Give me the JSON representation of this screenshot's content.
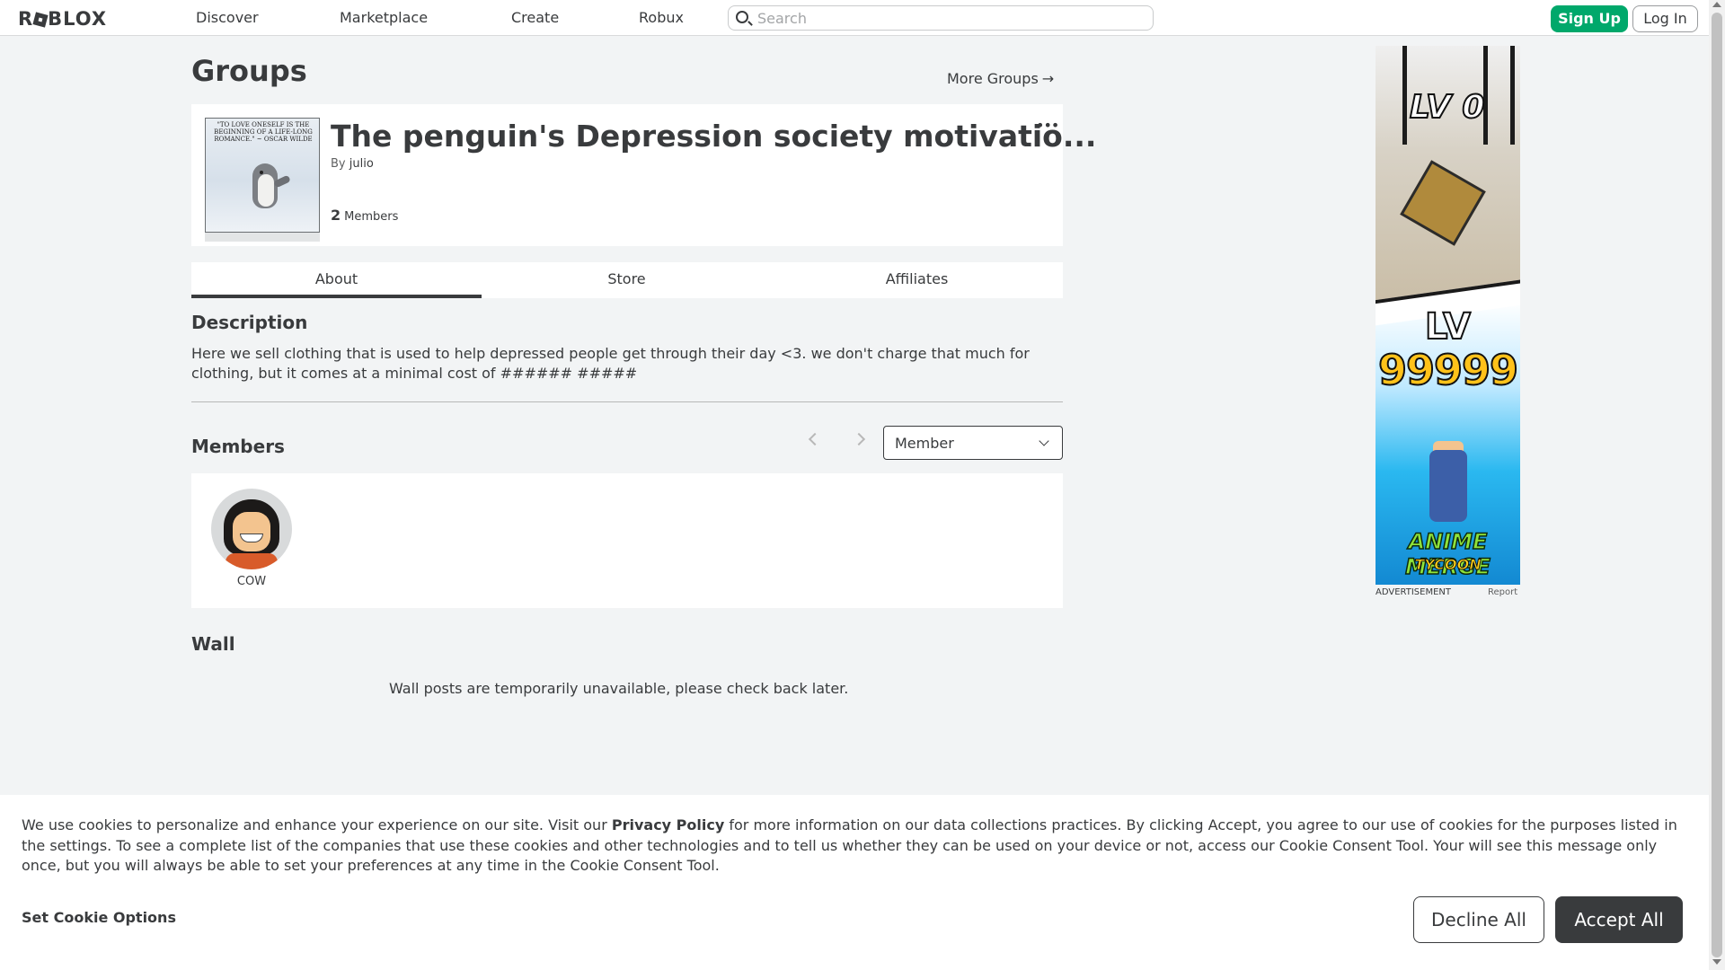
{
  "nav": {
    "logo": "ROBLOX",
    "links": [
      "Discover",
      "Marketplace",
      "Create",
      "Robux"
    ],
    "search_placeholder": "Search",
    "signup": "Sign Up",
    "login": "Log In"
  },
  "page": {
    "title": "Groups",
    "more_groups": "More Groups",
    "more_groups_arrow": "→"
  },
  "group": {
    "name": "The penguin's Depression society motivatio...",
    "by_label": "By",
    "owner": "julio",
    "member_count": "2",
    "members_label": "Members",
    "more_dots": "•••",
    "thumb_quote": "\"TO LOVE ONESELF IS THE BEGINNING OF A LIFE-LONG ROMANCE.\" ~ OSCAR WILDE"
  },
  "tabs": [
    "About",
    "Store",
    "Affiliates"
  ],
  "about": {
    "description_heading": "Description",
    "description": "Here we sell clothing that is used to help depressed people get through their day <3. we don't charge that much for clothing, but it comes at a minimal cost of ###### #####",
    "members_heading": "Members",
    "role_selected": "Member",
    "members": [
      {
        "name": "COW"
      }
    ],
    "wall_heading": "Wall",
    "wall_message": "Wall posts are temporarily unavailable, please check back later."
  },
  "ad": {
    "lv0": "LV 0",
    "lv": "LV",
    "lv_number": "99999",
    "title": "ANIME MERGE",
    "subtitle": "TYCOON",
    "label": "ADVERTISEMENT",
    "report": "Report"
  },
  "cookie": {
    "text_before": "We use cookies to personalize and enhance your experience on our site. Visit our ",
    "privacy_link": "Privacy Policy",
    "text_after": " for more information on our data collections practices. By clicking Accept, you agree to our use of cookies for the purposes listed in the settings. To see a complete list of the companies that use these cookies and other technologies and to tell us whether they can be used on your device or not, access our Cookie Consent Tool. Your will see this message only once, but you will always be able to set your preferences at any time in the Cookie Consent Tool.",
    "set_options": "Set Cookie Options",
    "decline": "Decline All",
    "accept": "Accept All"
  },
  "colors": {
    "accent_green": "#00a86b",
    "text": "#393b3d",
    "background": "#f2f4f5"
  }
}
